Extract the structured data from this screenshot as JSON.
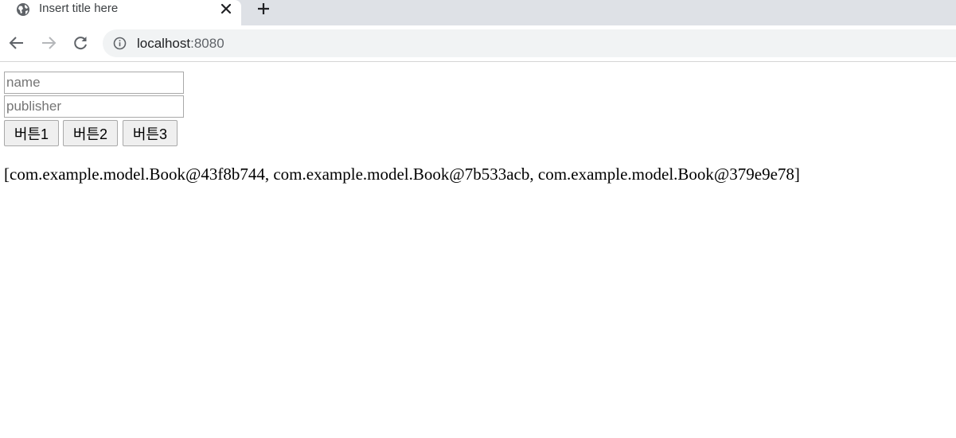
{
  "browser": {
    "tab_title": "Insert title here",
    "tab_favicon_icon": "globe-icon",
    "tab_close_icon": "close-icon",
    "new_tab_icon": "plus-icon",
    "back_icon": "arrow-left-icon",
    "forward_icon": "arrow-right-icon",
    "reload_icon": "reload-icon",
    "site_info_icon": "info-icon",
    "url_host": "localhost",
    "url_port": ":8080"
  },
  "form": {
    "name_placeholder": "name",
    "name_value": "",
    "publisher_placeholder": "publisher",
    "publisher_value": "",
    "buttons": [
      {
        "label": "버튼1"
      },
      {
        "label": "버튼2"
      },
      {
        "label": "버튼3"
      }
    ]
  },
  "result_text": "[com.example.model.Book@43f8b744, com.example.model.Book@7b533acb, com.example.model.Book@379e9e78]"
}
